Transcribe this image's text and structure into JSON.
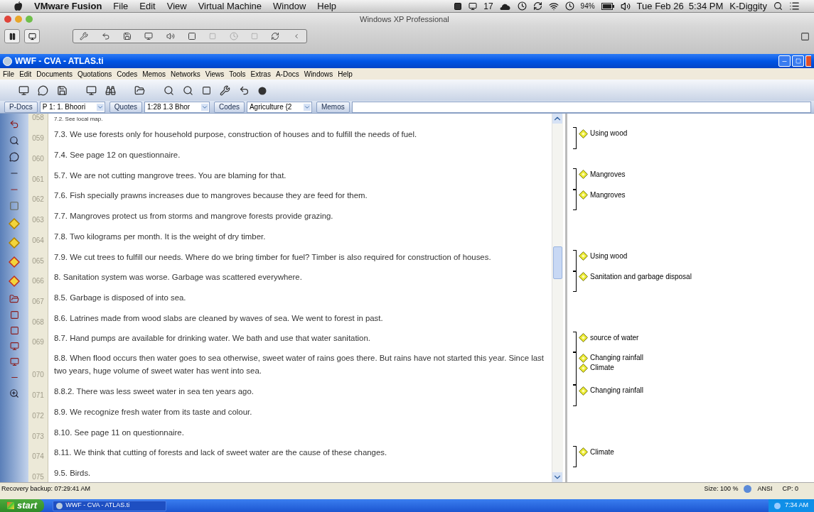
{
  "mac_menu_bar": {
    "app": "VMware Fusion",
    "menus": [
      "File",
      "Edit",
      "View",
      "Virtual Machine",
      "Window",
      "Help"
    ],
    "status": {
      "badge_count": "17",
      "battery": "94%",
      "clock": "Tue Feb 26  5:34 PM",
      "user": "K-Diggity"
    }
  },
  "vmware_window": {
    "title": "Windows XP Professional"
  },
  "app_window": {
    "title": "WWF - CVA - ATLAS.ti"
  },
  "menu_bar": [
    "File",
    "Edit",
    "Documents",
    "Quotations",
    "Codes",
    "Memos",
    "Networks",
    "Views",
    "Tools",
    "Extras",
    "A-Docs",
    "Windows",
    "Help"
  ],
  "doc_bar": [
    {
      "kind": "button",
      "label": "P-Docs"
    },
    {
      "kind": "dropdown",
      "value": "P 1: 1. Bhoori"
    },
    {
      "kind": "button",
      "label": "Quotes"
    },
    {
      "kind": "dropdown",
      "value": "1:28 1.3 Bhor"
    },
    {
      "kind": "button",
      "label": "Codes"
    },
    {
      "kind": "dropdown",
      "value": "Agriculture {2"
    },
    {
      "kind": "button",
      "label": "Memos"
    },
    {
      "kind": "field"
    }
  ],
  "document": {
    "rows": [
      {
        "number": "058",
        "text": "7.2. See local map."
      },
      {
        "number": "059",
        "text": "7.3. We use forests only for household purpose, construction of houses and to fulfill the needs of fuel.",
        "codes": [
          "Using wood"
        ]
      },
      {
        "number": "060",
        "text": "7.4. See page 12 on questionnaire."
      },
      {
        "number": "061",
        "text": "5.7. We are not cutting mangrove trees. You are blaming for that.",
        "codes": [
          "Mangroves"
        ]
      },
      {
        "number": "062",
        "text": "7.6. Fish specially prawns increases due to mangroves because they are feed for them.",
        "codes": [
          "Mangroves"
        ]
      },
      {
        "number": "063",
        "text": "7.7. Mangroves protect us from storms and mangrove forests provide grazing."
      },
      {
        "number": "064",
        "text": "7.8. Two kilograms per month. It is the weight of dry timber."
      },
      {
        "number": "065",
        "text": "7.9. We cut trees to fulfill our needs. Where do we bring timber for fuel?  Timber is also required for construction of houses.",
        "codes": [
          "Using wood"
        ]
      },
      {
        "number": "066",
        "text": "8. Sanitation system was worse. Garbage was scattered everywhere.",
        "codes": [
          "Sanitation and garbage disposal"
        ]
      },
      {
        "number": "067",
        "text": "8.5. Garbage is disposed of into sea."
      },
      {
        "number": "068",
        "text": "8.6. Latrines made from wood slabs are cleaned by waves of sea. We went to forest in past."
      },
      {
        "number": "069",
        "text": "8.7. Hand pumps are available for drinking water. We bath and use that water sanitation.",
        "codes": [
          "source of water"
        ]
      },
      {
        "number": "070",
        "text": "8.8. When flood occurs then water goes to sea otherwise, sweet water of rains goes there. But rains have not started this year. Since last two years, huge volume of sweet water has went into sea.",
        "codes": [
          "Changing rainfall",
          "Climate"
        ]
      },
      {
        "number": "071",
        "text": "8.8.2. There was less sweet water in sea ten years ago.",
        "codes": [
          "Changing rainfall"
        ]
      },
      {
        "number": "072",
        "text": "8.9. We recognize fresh water from its taste and colour."
      },
      {
        "number": "073",
        "text": "8.10. See page 11 on questionnaire."
      },
      {
        "number": "074",
        "text": "8.11. We think that cutting of forests and lack of sweet water are the cause of these changes.",
        "codes": [
          "Climate"
        ]
      },
      {
        "number": "075",
        "text": "9.5. Birds."
      }
    ]
  },
  "status_bar": {
    "message": "Recovery backup: 07:29:41 AM",
    "size": "Size: 100 %",
    "encoding": "ANSI",
    "codepage": "CP: 0"
  },
  "taskbar": {
    "start": "start",
    "task": "WWF - CVA - ATLAS.ti",
    "clock": "7:34 AM"
  }
}
